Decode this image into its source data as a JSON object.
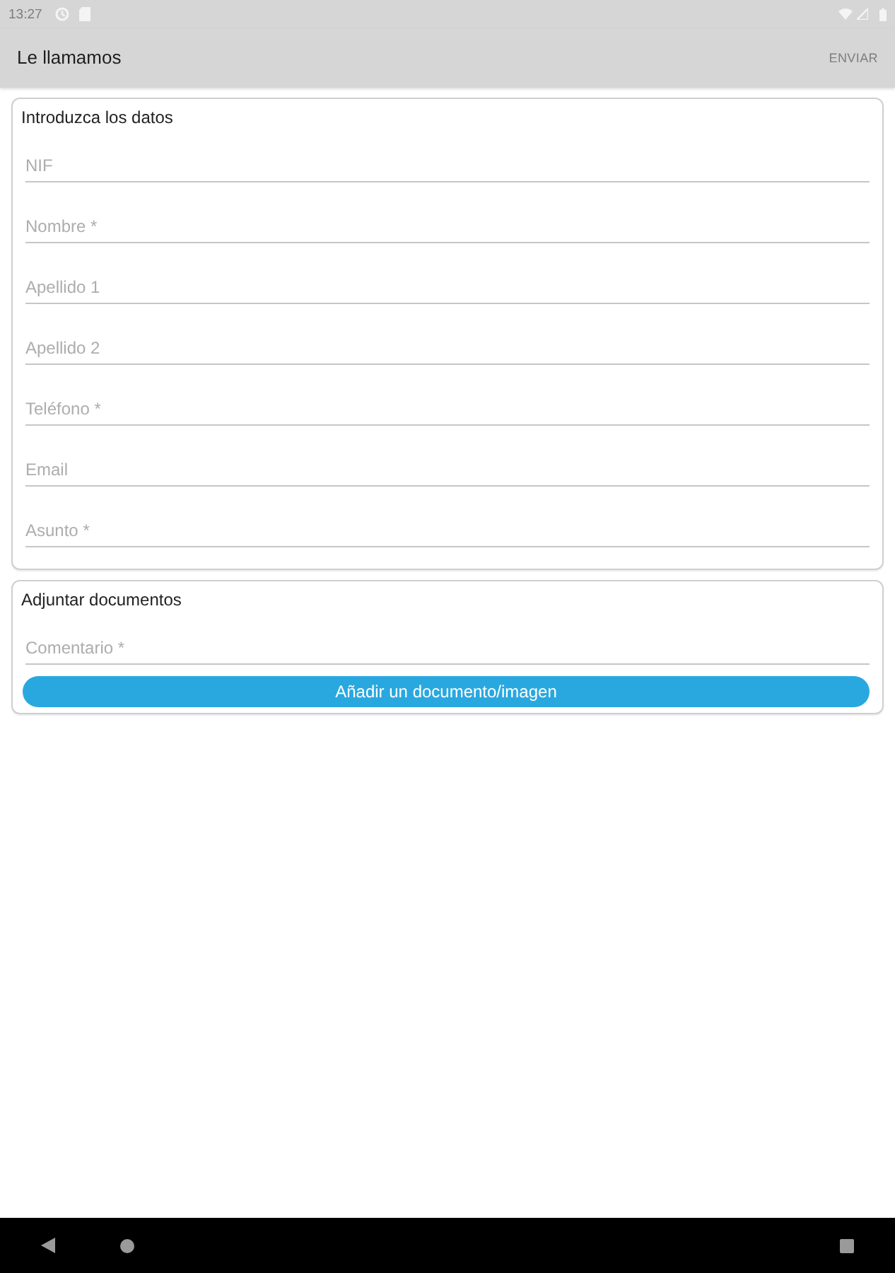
{
  "status_bar": {
    "time": "13:27"
  },
  "app_bar": {
    "title": "Le llamamos",
    "action": {
      "label": "ENVIAR",
      "disabled": true
    }
  },
  "sections": [
    {
      "title": "Introduzca los datos",
      "fields": [
        {
          "placeholder": "NIF"
        },
        {
          "placeholder": "Nombre *"
        },
        {
          "placeholder": "Apellido 1"
        },
        {
          "placeholder": "Apellido 2"
        },
        {
          "placeholder": "Teléfono *"
        },
        {
          "placeholder": "Email"
        },
        {
          "placeholder": "Asunto *"
        }
      ]
    },
    {
      "title": "Adjuntar documentos",
      "fields": [
        {
          "placeholder": "Comentario *"
        }
      ],
      "button": {
        "label": "Añadir un documento/imagen"
      }
    }
  ]
}
